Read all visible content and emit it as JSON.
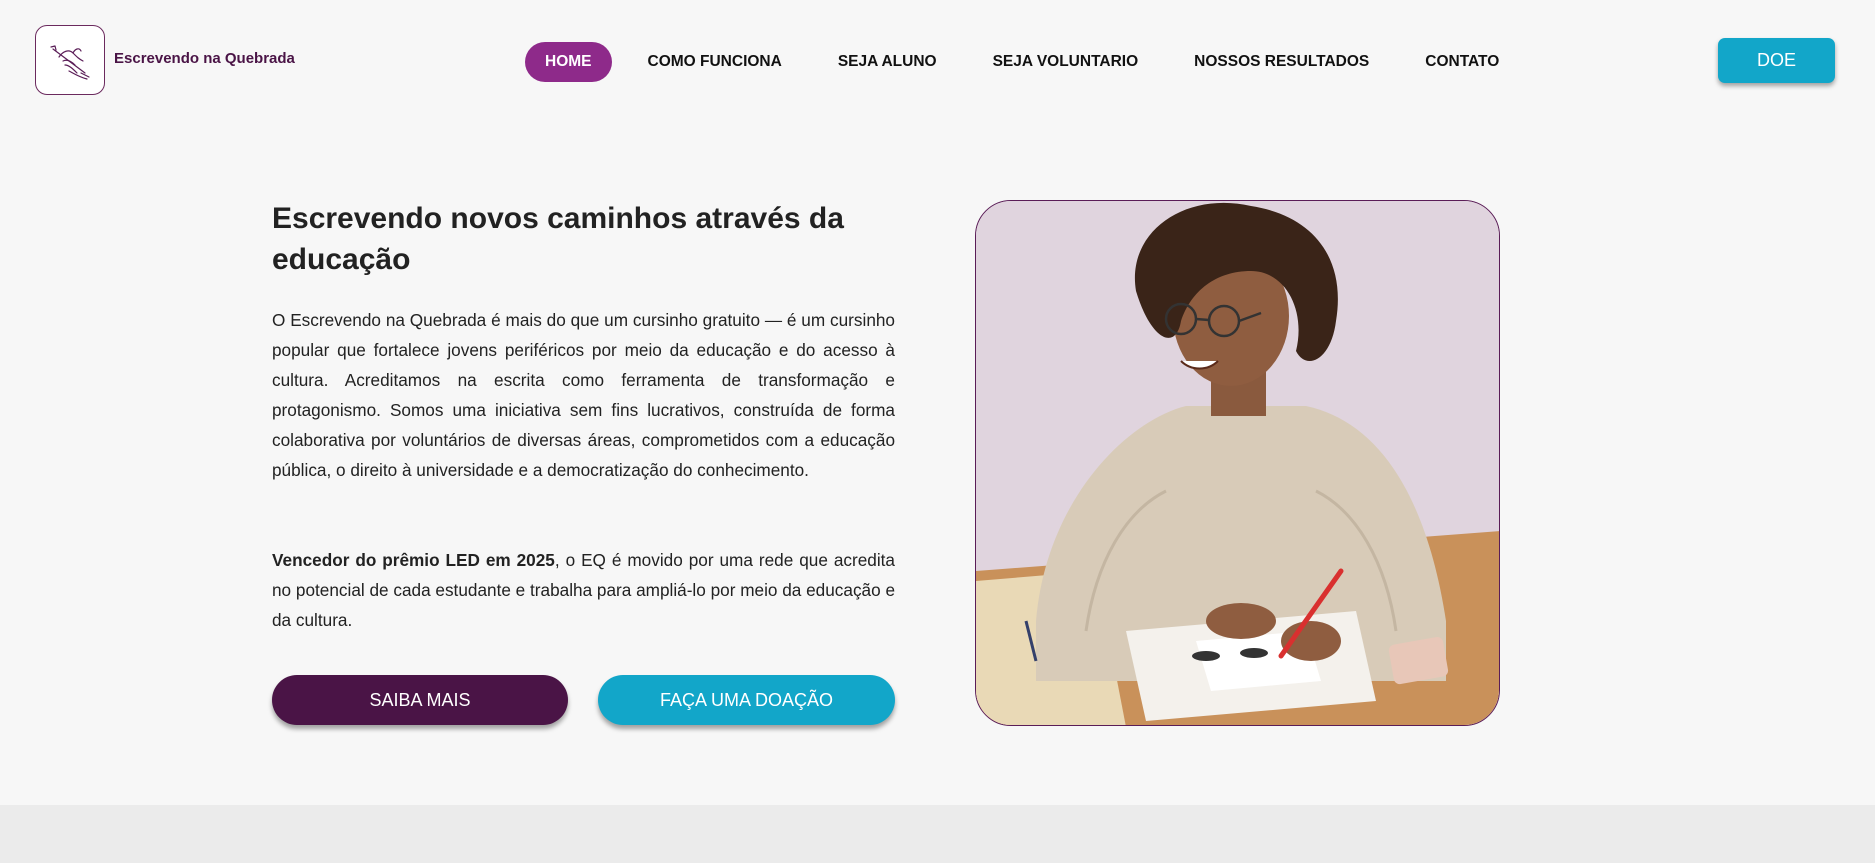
{
  "brand": {
    "name": "Escrevendo na Quebrada",
    "logo_icon": "hand-writing-icon"
  },
  "nav": {
    "items": [
      {
        "label": "HOME",
        "active": true
      },
      {
        "label": "COMO FUNCIONA",
        "active": false
      },
      {
        "label": "SEJA ALUNO",
        "active": false
      },
      {
        "label": "SEJA VOLUNTARIO",
        "active": false
      },
      {
        "label": "NOSSOS RESULTADOS",
        "active": false
      },
      {
        "label": "CONTATO",
        "active": false
      }
    ],
    "donate_label": "DOE"
  },
  "hero": {
    "title": "Escrevendo novos caminhos através da educação",
    "paragraph1": "O Escrevendo na Quebrada é mais do que um cursinho gratuito — é um cursinho popular que fortalece jovens periféricos por meio da educação e do acesso à cultura. Acreditamos na escrita como ferramenta de transformação e protagonismo. Somos uma iniciativa sem fins lucrativos, construída de forma colaborativa por voluntários de diversas áreas, comprometidos com a educação pública, o direito à universidade e a democratização do conhecimento.",
    "paragraph2_bold": "Vencedor do prêmio LED em 2025",
    "paragraph2_rest": ", o EQ é movido por uma rede que acredita no potencial de cada estudante e trabalha para ampliá-lo por meio da educação e da cultura.",
    "primary_button": "SAIBA MAIS",
    "secondary_button": "FAÇA UMA DOAÇÃO"
  },
  "colors": {
    "accent_purple": "#8e2a8a",
    "dark_purple": "#4a1446",
    "accent_blue": "#12a6c9",
    "background": "#f7f7f7"
  }
}
